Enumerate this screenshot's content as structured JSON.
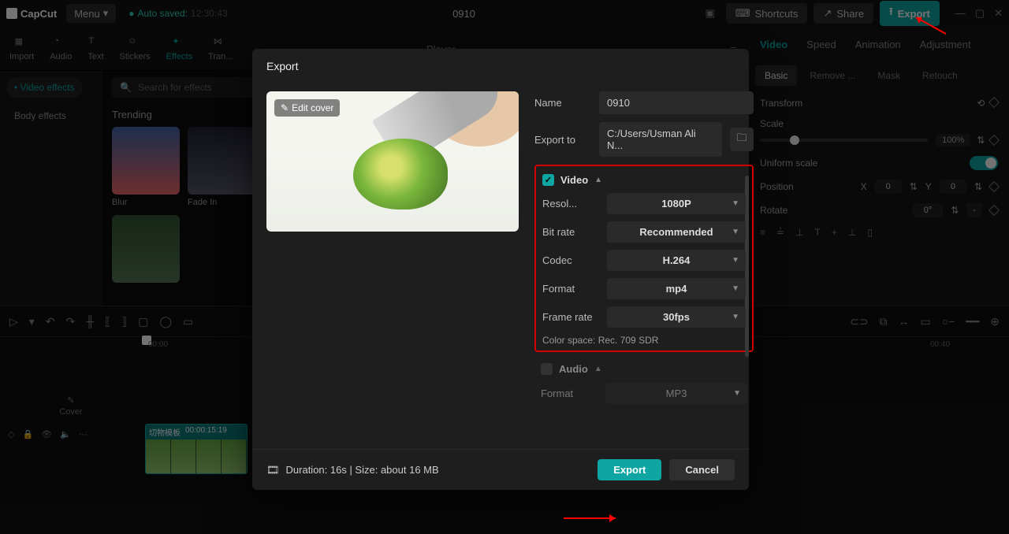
{
  "topbar": {
    "brand": "CapCut",
    "menu": "Menu",
    "autosave_label": "Auto saved:",
    "autosave_time": "12:30:43",
    "project": "0910",
    "shortcuts": "Shortcuts",
    "share": "Share",
    "export": "Export",
    "win_min": "—",
    "win_max": "▢",
    "win_close": "✕"
  },
  "lefttabs": {
    "import": "Import",
    "audio": "Audio",
    "text": "Text",
    "stickers": "Stickers",
    "effects": "Effects",
    "transition": "Tran..."
  },
  "leftside": {
    "video_effects": "Video effects",
    "body_effects": "Body effects"
  },
  "leftcontent": {
    "search_placeholder": "Search for effects",
    "trending": "Trending",
    "thumbs": [
      {
        "label": "Blur"
      },
      {
        "label": "Fade In"
      },
      {
        "label": ""
      },
      {
        "label": ""
      }
    ]
  },
  "player": {
    "label": "Player"
  },
  "right": {
    "tabs": {
      "video": "Video",
      "speed": "Speed",
      "animation": "Animation",
      "adjustment": "Adjustment"
    },
    "subtabs": {
      "basic": "Basic",
      "remove": "Remove ...",
      "mask": "Mask",
      "retouch": "Retouch"
    },
    "transform": "Transform",
    "scale": "Scale",
    "scale_val": "100%",
    "uniform": "Uniform scale",
    "position": "Position",
    "pos_x_label": "X",
    "pos_x": "0",
    "pos_y_label": "Y",
    "pos_y": "0",
    "rotate": "Rotate",
    "rotate_val": "0°",
    "rotate_dash": "-"
  },
  "tl": {
    "t0": "00:00",
    "t1": "00:40",
    "cover": "Cover",
    "clip_name": "切物模板",
    "clip_dur": "00:00:15:19"
  },
  "dialog": {
    "title": "Export",
    "edit_cover": "Edit cover",
    "name_label": "Name",
    "name_value": "0910",
    "exportto_label": "Export to",
    "exportto_value": "C:/Users/Usman Ali N...",
    "video_label": "Video",
    "rows": {
      "resolution_label": "Resol...",
      "resolution_value": "1080P",
      "bitrate_label": "Bit rate",
      "bitrate_value": "Recommended",
      "codec_label": "Codec",
      "codec_value": "H.264",
      "format_label": "Format",
      "format_value": "mp4",
      "framerate_label": "Frame rate",
      "framerate_value": "30fps"
    },
    "colorspace": "Color space: Rec. 709 SDR",
    "audio_label": "Audio",
    "audio_format_label": "Format",
    "audio_format_value": "MP3",
    "footer_info": "Duration: 16s | Size: about 16 MB",
    "export_btn": "Export",
    "cancel_btn": "Cancel"
  }
}
